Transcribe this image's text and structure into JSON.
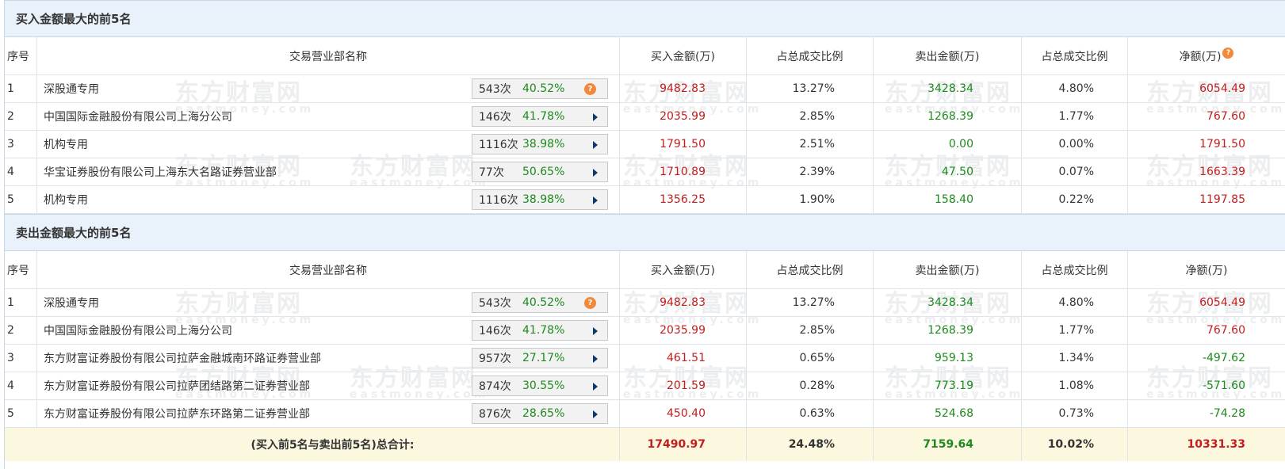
{
  "watermark": {
    "cn": "东方财富网",
    "en": "eastmoney.com"
  },
  "headers": {
    "no": "序号",
    "name": "交易营业部名称",
    "buy": "买入金额(万)",
    "buy_pct": "占总成交比例",
    "sell": "卖出金额(万)",
    "sell_pct": "占总成交比例",
    "net": "净额(万)"
  },
  "help_icon": "?",
  "buy_section": {
    "title": "买入金额最大的前5名",
    "rows": [
      {
        "no": "1",
        "name": "深股通专用",
        "times": "543次",
        "win": "40.52%",
        "tag_icon": "help-icon",
        "buy": "9482.83",
        "buy_pct": "13.27%",
        "sell": "3428.34",
        "sell_pct": "4.80%",
        "net": "6054.49"
      },
      {
        "no": "2",
        "name": "中国国际金融股份有限公司上海分公司",
        "times": "146次",
        "win": "41.78%",
        "tag_icon": "arrow-right-icon",
        "buy": "2035.99",
        "buy_pct": "2.85%",
        "sell": "1268.39",
        "sell_pct": "1.77%",
        "net": "767.60"
      },
      {
        "no": "3",
        "name": "机构专用",
        "times": "1116次",
        "win": "38.98%",
        "tag_icon": "arrow-right-icon",
        "buy": "1791.50",
        "buy_pct": "2.51%",
        "sell": "0.00",
        "sell_pct": "0.00%",
        "net": "1791.50"
      },
      {
        "no": "4",
        "name": "华宝证券股份有限公司上海东大名路证券营业部",
        "times": "77次",
        "win": "50.65%",
        "win_red": true,
        "tag_icon": "arrow-right-icon",
        "buy": "1710.89",
        "buy_pct": "2.39%",
        "sell": "47.50",
        "sell_pct": "0.07%",
        "net": "1663.39"
      },
      {
        "no": "5",
        "name": "机构专用",
        "times": "1116次",
        "win": "38.98%",
        "tag_icon": "arrow-right-icon",
        "buy": "1356.25",
        "buy_pct": "1.90%",
        "sell": "158.40",
        "sell_pct": "0.22%",
        "net": "1197.85"
      }
    ]
  },
  "sell_section": {
    "title": "卖出金额最大的前5名",
    "rows": [
      {
        "no": "1",
        "name": "深股通专用",
        "times": "543次",
        "win": "40.52%",
        "tag_icon": "help-icon",
        "buy": "9482.83",
        "buy_pct": "13.27%",
        "sell": "3428.34",
        "sell_pct": "4.80%",
        "net": "6054.49"
      },
      {
        "no": "2",
        "name": "中国国际金融股份有限公司上海分公司",
        "times": "146次",
        "win": "41.78%",
        "tag_icon": "arrow-right-icon",
        "buy": "2035.99",
        "buy_pct": "2.85%",
        "sell": "1268.39",
        "sell_pct": "1.77%",
        "net": "767.60"
      },
      {
        "no": "3",
        "name": "东方财富证券股份有限公司拉萨金融城南环路证券营业部",
        "times": "957次",
        "win": "27.17%",
        "tag_icon": "arrow-right-icon",
        "buy": "461.51",
        "buy_pct": "0.65%",
        "sell": "959.13",
        "sell_pct": "1.34%",
        "net": "-497.62"
      },
      {
        "no": "4",
        "name": "东方财富证券股份有限公司拉萨团结路第二证券营业部",
        "times": "874次",
        "win": "30.55%",
        "tag_icon": "arrow-right-icon",
        "buy": "201.59",
        "buy_pct": "0.28%",
        "sell": "773.19",
        "sell_pct": "1.08%",
        "net": "-571.60"
      },
      {
        "no": "5",
        "name": "东方财富证券股份有限公司拉萨东环路第二证券营业部",
        "times": "876次",
        "win": "28.65%",
        "tag_icon": "arrow-right-icon",
        "buy": "450.40",
        "buy_pct": "0.63%",
        "sell": "524.68",
        "sell_pct": "0.73%",
        "net": "-74.28"
      }
    ]
  },
  "total": {
    "label": "(买入前5名与卖出前5名)总合计:",
    "buy": "17490.97",
    "buy_pct": "24.48%",
    "sell": "7159.64",
    "sell_pct": "10.02%",
    "net": "10331.33"
  },
  "colors": {
    "buy": "#c21e1e",
    "sell": "#1d8a1d",
    "net_positive": "#c21e1e",
    "net_negative": "#1d8a1d"
  }
}
